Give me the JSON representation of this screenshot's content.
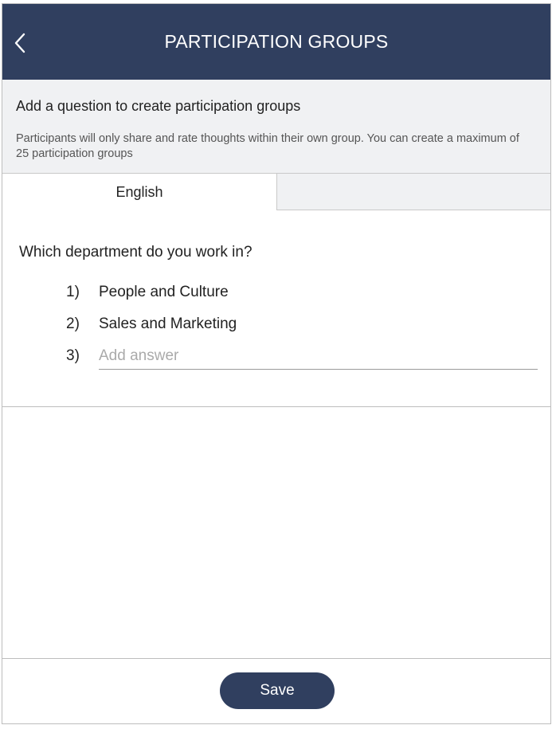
{
  "header": {
    "title": "PARTICIPATION GROUPS",
    "back_icon": "chevron-left-icon"
  },
  "info": {
    "title": "Add a question to create participation groups",
    "description": "Participants will only share and rate thoughts within their own group. You can create a maximum of 25 participation groups"
  },
  "tabs": [
    {
      "label": "English",
      "active": true
    },
    {
      "label": "",
      "active": false
    }
  ],
  "question": "Which department do you work in?",
  "answers": [
    {
      "number": "1)",
      "text": "People and Culture"
    },
    {
      "number": "2)",
      "text": "Sales and Marketing"
    }
  ],
  "new_answer": {
    "number": "3)",
    "value": "",
    "placeholder": "Add answer"
  },
  "footer": {
    "save_label": "Save"
  },
  "colors": {
    "header_bg": "#303f5f",
    "info_bg": "#f0f1f3",
    "button_bg": "#303f5f"
  }
}
